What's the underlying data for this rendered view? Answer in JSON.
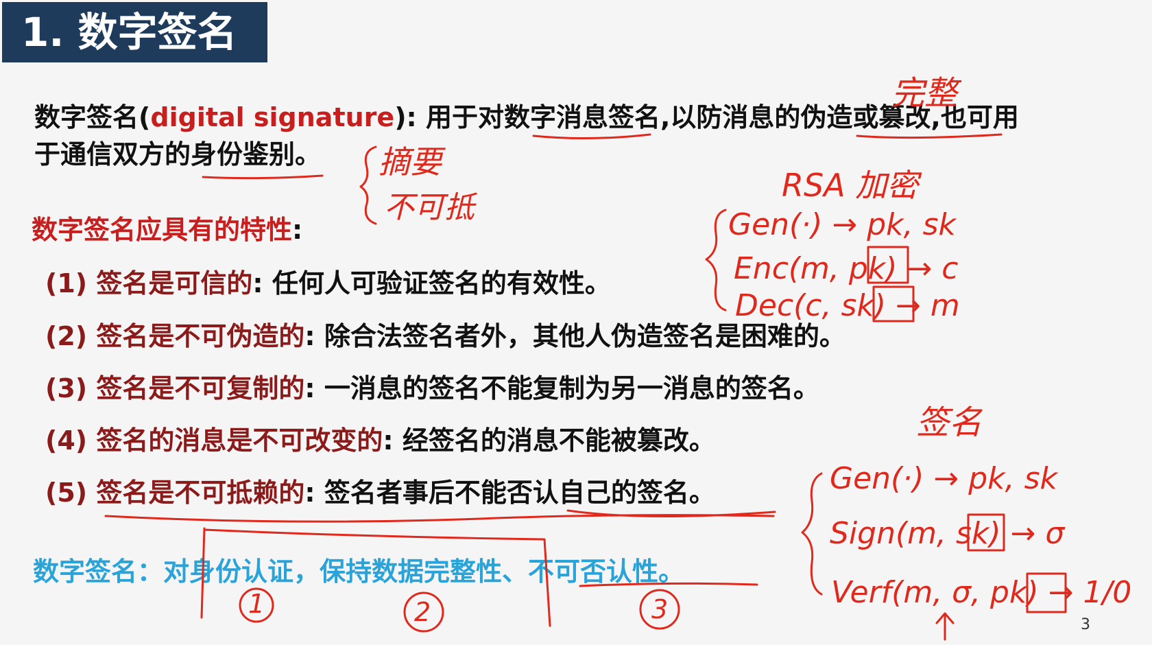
{
  "title": "1. 数字签名",
  "definition": {
    "term": "数字签名",
    "open": "(",
    "english": "digital signature",
    "close": "):",
    "text1": " 用于对数字消息签名,以防消息的伪造或篡改,也可用",
    "text2": "于通信双方的身份鉴别。"
  },
  "properties_title": "数字签名应具有的特性",
  "properties_colon": ":",
  "properties": [
    {
      "num": "(1)",
      "label": " 签名是可信的",
      "colon": ":",
      "desc": " 任何人可验证签名的有效性。"
    },
    {
      "num": "(2)",
      "label": " 签名是不可伪造的",
      "colon": ":",
      "desc": " 除合法签名者外，其他人伪造签名是困难的。"
    },
    {
      "num": "(3)",
      "label": " 签名是不可复制的",
      "colon": ":",
      "desc": " 一消息的签名不能复制为另一消息的签名。"
    },
    {
      "num": "(4)",
      "label": " 签名的消息是不可改变的",
      "colon": ":",
      "desc": " 经签名的消息不能被篡改。"
    },
    {
      "num": "(5)",
      "label": " 签名是不可抵赖的",
      "colon": ":",
      "desc": " 签名者事后不能否认自己的签名。"
    }
  ],
  "summary": "数字签名：对身份认证，保持数据完整性、不可否认性。",
  "page_number": "3",
  "annotations": {
    "integrity": "完整",
    "summary_note_1": "摘要",
    "summary_note_2": "不可抵",
    "rsa": "RSA 加密",
    "gen1": "Gen(·) → pk, sk",
    "enc": "Enc(m, pk) → c",
    "dec": "Dec(c, sk) → m",
    "sign_title": "签名",
    "gen2": "Gen(·) → pk, sk",
    "sign": "Sign(m, sk) → σ",
    "verf": "Verf(m, σ, pk) → 1/0",
    "circle1": "1",
    "circle2": "2",
    "circle3": "3"
  },
  "colors": {
    "title_bg": "#1f3b5c",
    "accent_red": "#c81e1e",
    "dark_red": "#8b1a1a",
    "blue": "#2aa3d9",
    "ink": "#e0291d"
  }
}
